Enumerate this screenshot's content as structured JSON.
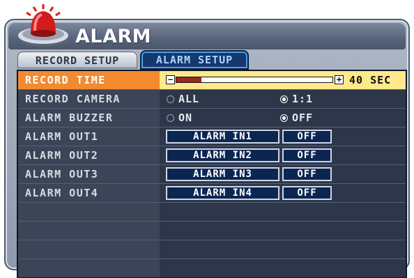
{
  "window": {
    "title": "ALARM"
  },
  "tabs": [
    {
      "label": "RECORD SETUP",
      "active": false
    },
    {
      "label": "ALARM SETUP",
      "active": true
    }
  ],
  "record_time": {
    "label": "RECORD TIME",
    "minus": "⊟",
    "plus": "⊞",
    "value_text": "40 SEC",
    "fill_fraction": 0.16
  },
  "record_camera": {
    "label": "RECORD CAMERA",
    "options": [
      {
        "label": "ALL",
        "selected": false
      },
      {
        "label": "1:1",
        "selected": true
      }
    ]
  },
  "alarm_buzzer": {
    "label": "ALARM BUZZER",
    "options": [
      {
        "label": "ON",
        "selected": false
      },
      {
        "label": "OFF",
        "selected": true
      }
    ]
  },
  "alarm_outs": [
    {
      "label": "ALARM OUT1",
      "input": "ALARM IN1",
      "state": "OFF"
    },
    {
      "label": "ALARM OUT2",
      "input": "ALARM IN2",
      "state": "OFF"
    },
    {
      "label": "ALARM OUT3",
      "input": "ALARM IN3",
      "state": "OFF"
    },
    {
      "label": "ALARM OUT4",
      "input": "ALARM IN4",
      "state": "OFF"
    }
  ],
  "icon": "siren-icon",
  "colors": {
    "selected_label": "#f38a30",
    "selected_value": "#ffe98c",
    "active_tab": "#16386f",
    "panel": "#2e3649"
  }
}
